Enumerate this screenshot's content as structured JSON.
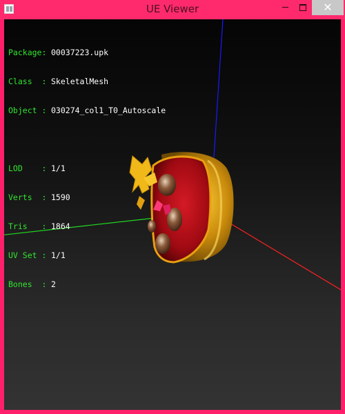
{
  "window": {
    "title": "UE Viewer",
    "buttons": {
      "minimize": "minimize",
      "maximize": "maximize",
      "close": "✕"
    }
  },
  "info": {
    "package": {
      "key": "Package:",
      "value": "00037223.upk"
    },
    "class": {
      "key": "Class  :",
      "value": "SkeletalMesh"
    },
    "object": {
      "key": "Object :",
      "value": "030274_col1_T0_Autoscale"
    },
    "lod": {
      "key": "LOD    :",
      "value": "1/1"
    },
    "verts": {
      "key": "Verts  :",
      "value": "1590"
    },
    "tris": {
      "key": "Tris   :",
      "value": "1864"
    },
    "uvset": {
      "key": "UV Set :",
      "value": "1/1"
    },
    "bones": {
      "key": "Bones  :",
      "value": "2"
    }
  },
  "colors": {
    "frame": "#ff1f6b",
    "label_green": "#31e62f",
    "axis_x": "#ff2020",
    "axis_y": "#22dd22",
    "axis_z": "#1a1aff",
    "box_red": "#c0101a",
    "box_gold": "#d49a10"
  }
}
